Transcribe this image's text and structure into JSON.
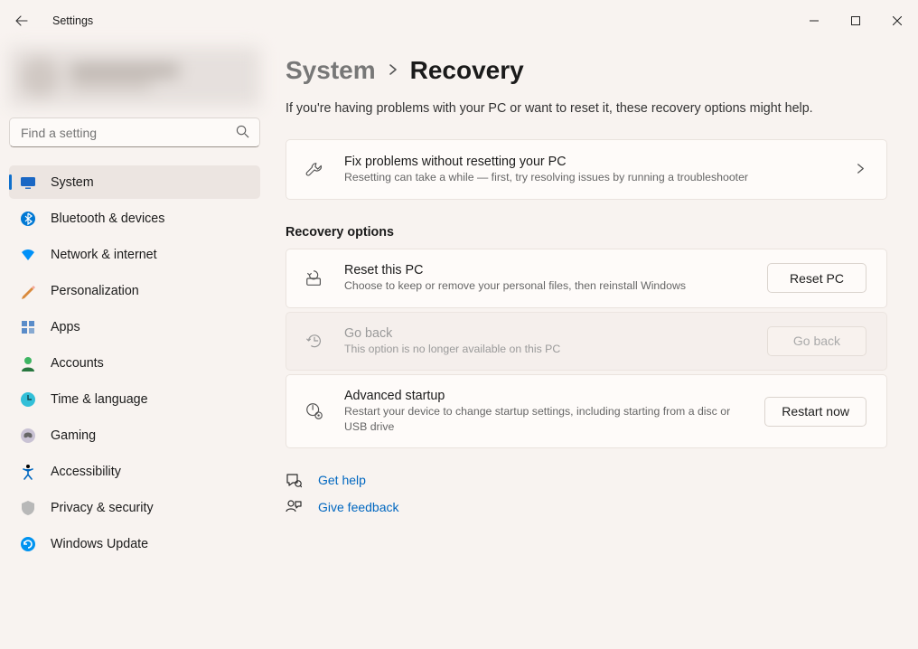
{
  "titlebar": {
    "title": "Settings"
  },
  "search": {
    "placeholder": "Find a setting"
  },
  "nav": {
    "items": [
      {
        "label": "System",
        "icon": "system",
        "active": true
      },
      {
        "label": "Bluetooth & devices",
        "icon": "bluetooth",
        "active": false
      },
      {
        "label": "Network & internet",
        "icon": "network",
        "active": false
      },
      {
        "label": "Personalization",
        "icon": "personalization",
        "active": false
      },
      {
        "label": "Apps",
        "icon": "apps",
        "active": false
      },
      {
        "label": "Accounts",
        "icon": "accounts",
        "active": false
      },
      {
        "label": "Time & language",
        "icon": "time",
        "active": false
      },
      {
        "label": "Gaming",
        "icon": "gaming",
        "active": false
      },
      {
        "label": "Accessibility",
        "icon": "accessibility",
        "active": false
      },
      {
        "label": "Privacy & security",
        "icon": "privacy",
        "active": false
      },
      {
        "label": "Windows Update",
        "icon": "update",
        "active": false
      }
    ]
  },
  "breadcrumb": {
    "parent": "System",
    "page": "Recovery"
  },
  "intro": "If you're having problems with your PC or want to reset it, these recovery options might help.",
  "troubleshoot": {
    "title": "Fix problems without resetting your PC",
    "sub": "Resetting can take a while — first, try resolving issues by running a troubleshooter"
  },
  "sectionTitle": "Recovery options",
  "reset": {
    "title": "Reset this PC",
    "sub": "Choose to keep or remove your personal files, then reinstall Windows",
    "button": "Reset PC"
  },
  "goback": {
    "title": "Go back",
    "sub": "This option is no longer available on this PC",
    "button": "Go back"
  },
  "advanced": {
    "title": "Advanced startup",
    "sub": "Restart your device to change startup settings, including starting from a disc or USB drive",
    "button": "Restart now"
  },
  "help": {
    "getHelp": "Get help",
    "giveFeedback": "Give feedback"
  }
}
